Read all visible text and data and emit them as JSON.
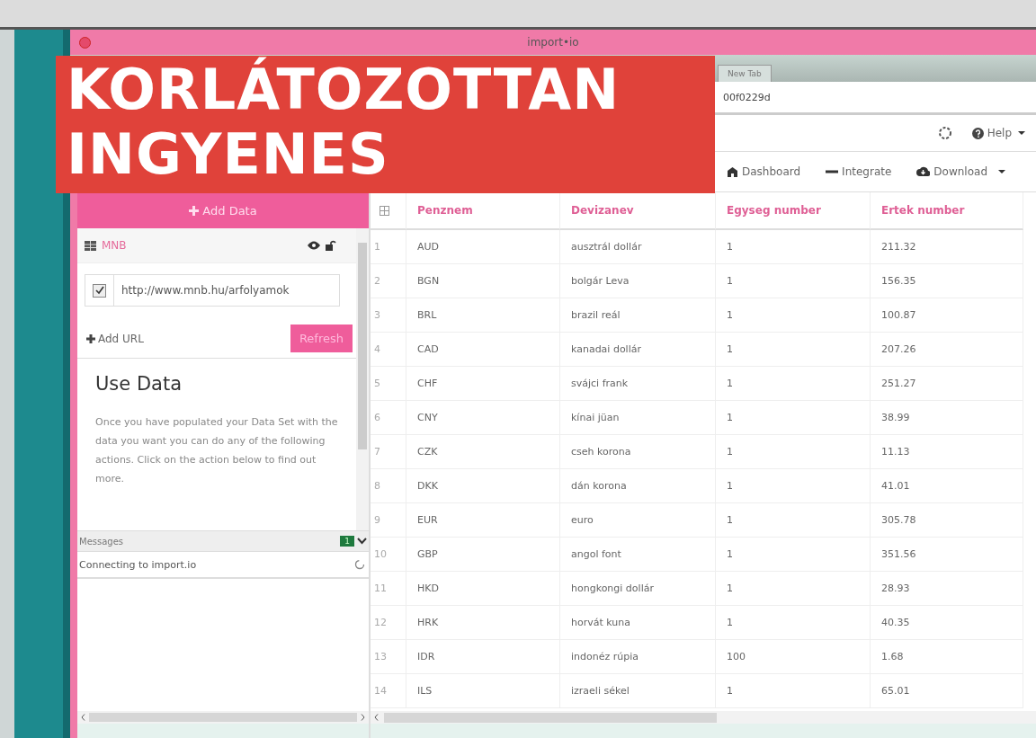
{
  "window": {
    "title": "import•io"
  },
  "browser": {
    "tab": "New Tab",
    "address": "00f0229d"
  },
  "toolbar": {
    "help": "Help"
  },
  "actions": [
    {
      "label": "Dashboard",
      "kind": "dashboard"
    },
    {
      "label": "Integrate",
      "kind": "integrate"
    },
    {
      "label": "Download",
      "kind": "download"
    }
  ],
  "sidebar": {
    "add_data": "Add Data",
    "source": {
      "name": "MNB",
      "url": "http://www.mnb.hu/arfolyamok",
      "checked": true
    },
    "add_url": "Add URL",
    "refresh": "Refresh",
    "use_data": {
      "title": "Use Data",
      "text": "Once you have populated your Data Set with the data you want you can do any of the following actions. Click on the action below to find out more."
    }
  },
  "messages": {
    "title": "Messages",
    "count": "1",
    "items": [
      "Connecting to import.io"
    ]
  },
  "table": {
    "columns": [
      "Penznem",
      "Devizanev",
      "Egyseg number",
      "Ertek number"
    ],
    "rows": [
      {
        "number": "1",
        "cells": [
          "AUD",
          "ausztrál dollár",
          "1",
          "211.32"
        ]
      },
      {
        "number": "2",
        "cells": [
          "BGN",
          "bolgár Leva",
          "1",
          "156.35"
        ]
      },
      {
        "number": "3",
        "cells": [
          "BRL",
          "brazil reál",
          "1",
          "100.87"
        ]
      },
      {
        "number": "4",
        "cells": [
          "CAD",
          "kanadai dollár",
          "1",
          "207.26"
        ]
      },
      {
        "number": "5",
        "cells": [
          "CHF",
          "svájci frank",
          "1",
          "251.27"
        ]
      },
      {
        "number": "6",
        "cells": [
          "CNY",
          "kínai jüan",
          "1",
          "38.99"
        ]
      },
      {
        "number": "7",
        "cells": [
          "CZK",
          "cseh korona",
          "1",
          "11.13"
        ]
      },
      {
        "number": "8",
        "cells": [
          "DKK",
          "dán korona",
          "1",
          "41.01"
        ]
      },
      {
        "number": "9",
        "cells": [
          "EUR",
          "euro",
          "1",
          "305.78"
        ]
      },
      {
        "number": "10",
        "cells": [
          "GBP",
          "angol font",
          "1",
          "351.56"
        ]
      },
      {
        "number": "11",
        "cells": [
          "HKD",
          "hongkongi dollár",
          "1",
          "28.93"
        ]
      },
      {
        "number": "12",
        "cells": [
          "HRK",
          "horvát kuna",
          "1",
          "40.35"
        ]
      },
      {
        "number": "13",
        "cells": [
          "IDR",
          "indonéz rúpia",
          "100",
          "1.68"
        ]
      },
      {
        "number": "14",
        "cells": [
          "ILS",
          "izraeli sékel",
          "1",
          "65.01"
        ]
      }
    ]
  },
  "banner": {
    "lines": [
      "KORLÁTOZOTTAN",
      "INGYENES"
    ]
  }
}
